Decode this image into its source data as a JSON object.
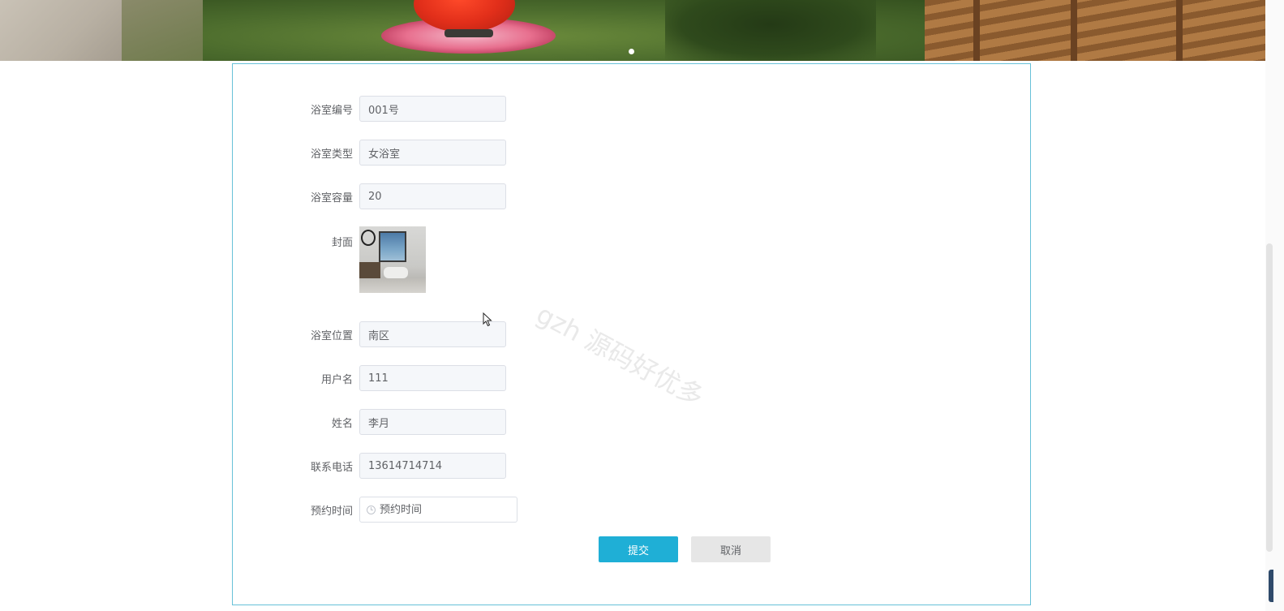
{
  "banner": {
    "slide_count": 1,
    "active_slide": 1
  },
  "form": {
    "fields": [
      {
        "label": "浴室编号",
        "value": "001号"
      },
      {
        "label": "浴室类型",
        "value": "女浴室"
      },
      {
        "label": "浴室容量",
        "value": "20"
      },
      {
        "label": "浴室位置",
        "value": "南区"
      },
      {
        "label": "用户名",
        "value": "111"
      },
      {
        "label": "姓名",
        "value": "李月"
      },
      {
        "label": "联系电话",
        "value": "13614714714"
      }
    ],
    "cover": {
      "label": "封面",
      "image": "bathroom-photo"
    },
    "booking_time": {
      "label": "预约时间",
      "placeholder": "预约时间",
      "icon": "clock-icon"
    },
    "submit_label": "提交",
    "cancel_label": "取消"
  },
  "watermark": "gzh 源码好优多",
  "colors": {
    "primary": "#1fafd6",
    "panel_border": "#67c1d8",
    "input_bg": "#f5f7fa",
    "cancel_bg": "#e6e6e6"
  }
}
